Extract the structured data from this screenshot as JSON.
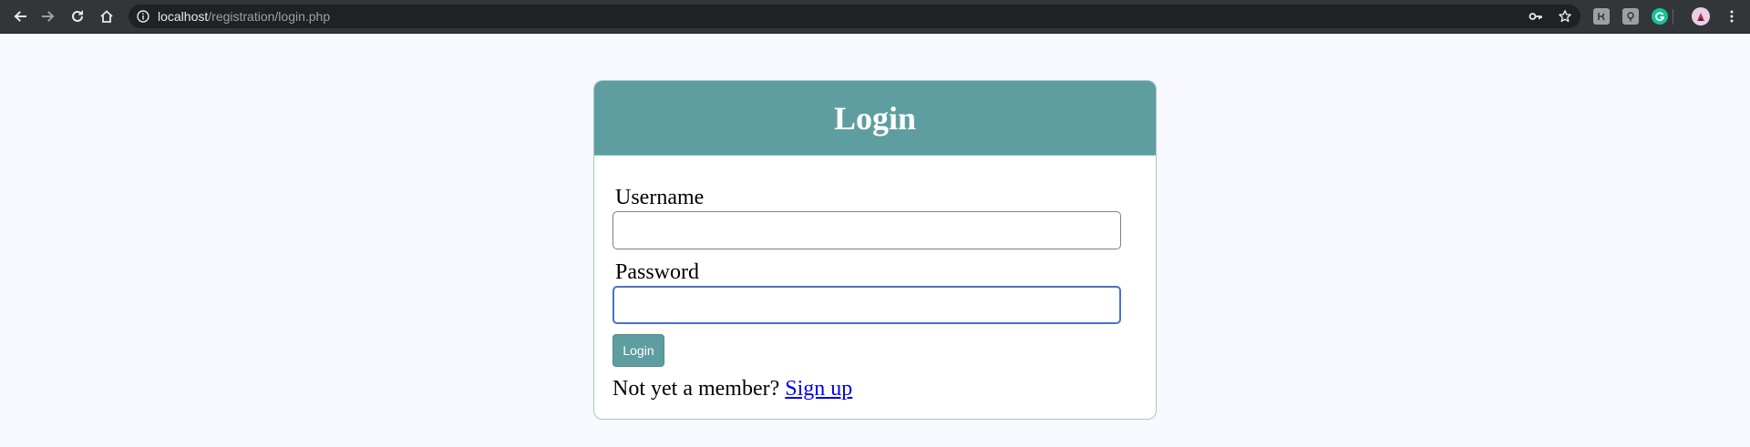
{
  "browser": {
    "url_host": "localhost",
    "url_path": "/registration/login.php"
  },
  "login": {
    "title": "Login",
    "username_label": "Username",
    "username_value": "",
    "password_label": "Password",
    "password_value": "",
    "submit_label": "Login",
    "signup_prompt": "Not yet a member? ",
    "signup_link": "Sign up"
  },
  "colors": {
    "header_bg": "#5f9ea0",
    "page_bg": "#f8f8ff",
    "link": "#0000ee"
  }
}
